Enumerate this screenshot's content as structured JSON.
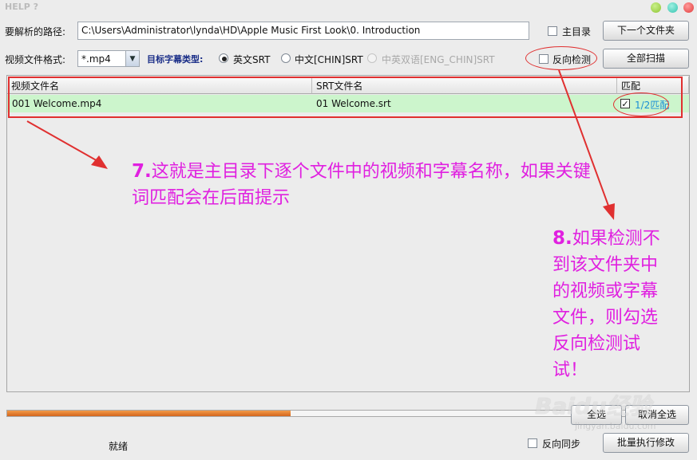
{
  "window": {
    "title": "HELP ?"
  },
  "path": {
    "label": "要解析的路径:",
    "value": "C:\\Users\\Administrator\\lynda\\HD\\Apple Music First Look\\0. Introduction"
  },
  "main_dir": {
    "label": "主目录",
    "checked": false
  },
  "next_folder_button": "下一个文件夹",
  "format": {
    "label": "视频文件格式:",
    "value": "*.mp4"
  },
  "subtitle_type": {
    "label": "目标字幕类型:",
    "options": [
      {
        "label": "英文SRT",
        "selected": true,
        "enabled": true
      },
      {
        "label": "中文[CHIN]SRT",
        "selected": false,
        "enabled": true
      },
      {
        "label": "中英双语[ENG_CHIN]SRT",
        "selected": false,
        "enabled": false
      }
    ]
  },
  "reverse_check": {
    "label": "反向检测",
    "checked": false
  },
  "scan_all_button": "全部扫描",
  "table": {
    "columns": [
      "视频文件名",
      "SRT文件名",
      "匹配"
    ],
    "rows": [
      {
        "video": "001 Welcome.mp4",
        "srt": "01 Welcome.srt",
        "checked": true,
        "match": "1/2匹配"
      }
    ]
  },
  "annotations": {
    "note7_num": "7.",
    "note7_line1": "这就是主目录下逐个文件中的视频和字幕名称，如果关键",
    "note7_line2": "词匹配会在后面提示",
    "note8_num": "8.",
    "note8_lines": [
      "如果检测不",
      "到该文件夹中",
      "的视频或字幕",
      "文件，则勾选",
      "反向检测试",
      "试！"
    ]
  },
  "progress": {
    "fraction": 0.42
  },
  "select_all_button": "全选",
  "deselect_all_button": "取消全选",
  "status": "就绪",
  "reverse_sync": {
    "label": "反向同步",
    "checked": false
  },
  "batch_modify_button": "批量执行修改",
  "watermark": {
    "brand": "Baidu经验",
    "url": "jingyan.baidu.com"
  },
  "colors": {
    "annotation": "#e020e0",
    "highlight_red": "#e03030",
    "row_green": "#ccf5cc",
    "progress_orange": "#e07b2e"
  }
}
